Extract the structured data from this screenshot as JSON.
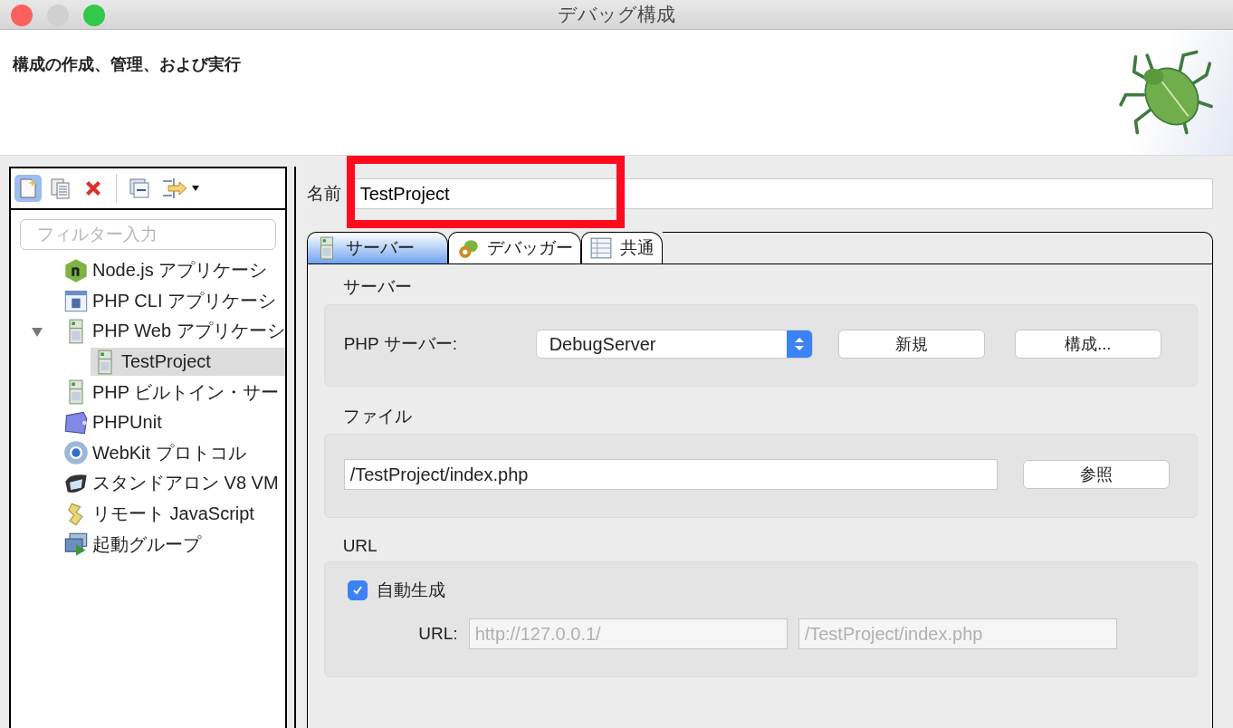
{
  "window": {
    "title": "デバッグ構成"
  },
  "header": {
    "title": "構成の作成、管理、および実行"
  },
  "filter": {
    "placeholder": "フィルター入力"
  },
  "tree": [
    {
      "label": "Node.js アプリケーシ",
      "kind": "node",
      "selected": false
    },
    {
      "label": "PHP CLI アプリケーシ",
      "kind": "cli",
      "selected": false
    },
    {
      "label": "PHP Web アプリケーシ",
      "kind": "server",
      "selected": false,
      "expanded": true,
      "children": [
        {
          "label": "TestProject",
          "kind": "server",
          "selected": true
        }
      ]
    },
    {
      "label": "PHP ビルトイン・サー",
      "kind": "server",
      "selected": false
    },
    {
      "label": "PHPUnit",
      "kind": "unit",
      "selected": false
    },
    {
      "label": "WebKit プロトコル",
      "kind": "webkit",
      "selected": false
    },
    {
      "label": "スタンドアロン V8 VM",
      "kind": "v8",
      "selected": false
    },
    {
      "label": "リモート JavaScript",
      "kind": "script",
      "selected": false
    },
    {
      "label": "起動グループ",
      "kind": "group",
      "selected": false
    }
  ],
  "name": {
    "label": "名前",
    "value": "TestProject"
  },
  "tabs": [
    {
      "label": "サーバー",
      "kind": "server",
      "selected": true
    },
    {
      "label": "デバッガー",
      "kind": "debugger",
      "selected": false
    },
    {
      "label": "共通",
      "kind": "common",
      "selected": false
    }
  ],
  "server_group": {
    "heading": "サーバー",
    "label": "PHP サーバー:",
    "value": "DebugServer",
    "buttons": [
      "新規",
      "構成..."
    ]
  },
  "file_group": {
    "heading": "ファイル",
    "value": "/TestProject/index.php",
    "button": "参照"
  },
  "url_group": {
    "heading": "URL",
    "checkbox": {
      "label": "自動生成",
      "checked": true
    },
    "label": "URL:",
    "fields": [
      {
        "value": "http://127.0.0.1/",
        "disabled": true
      },
      {
        "value": "/TestProject/index.php",
        "disabled": true
      }
    ]
  }
}
